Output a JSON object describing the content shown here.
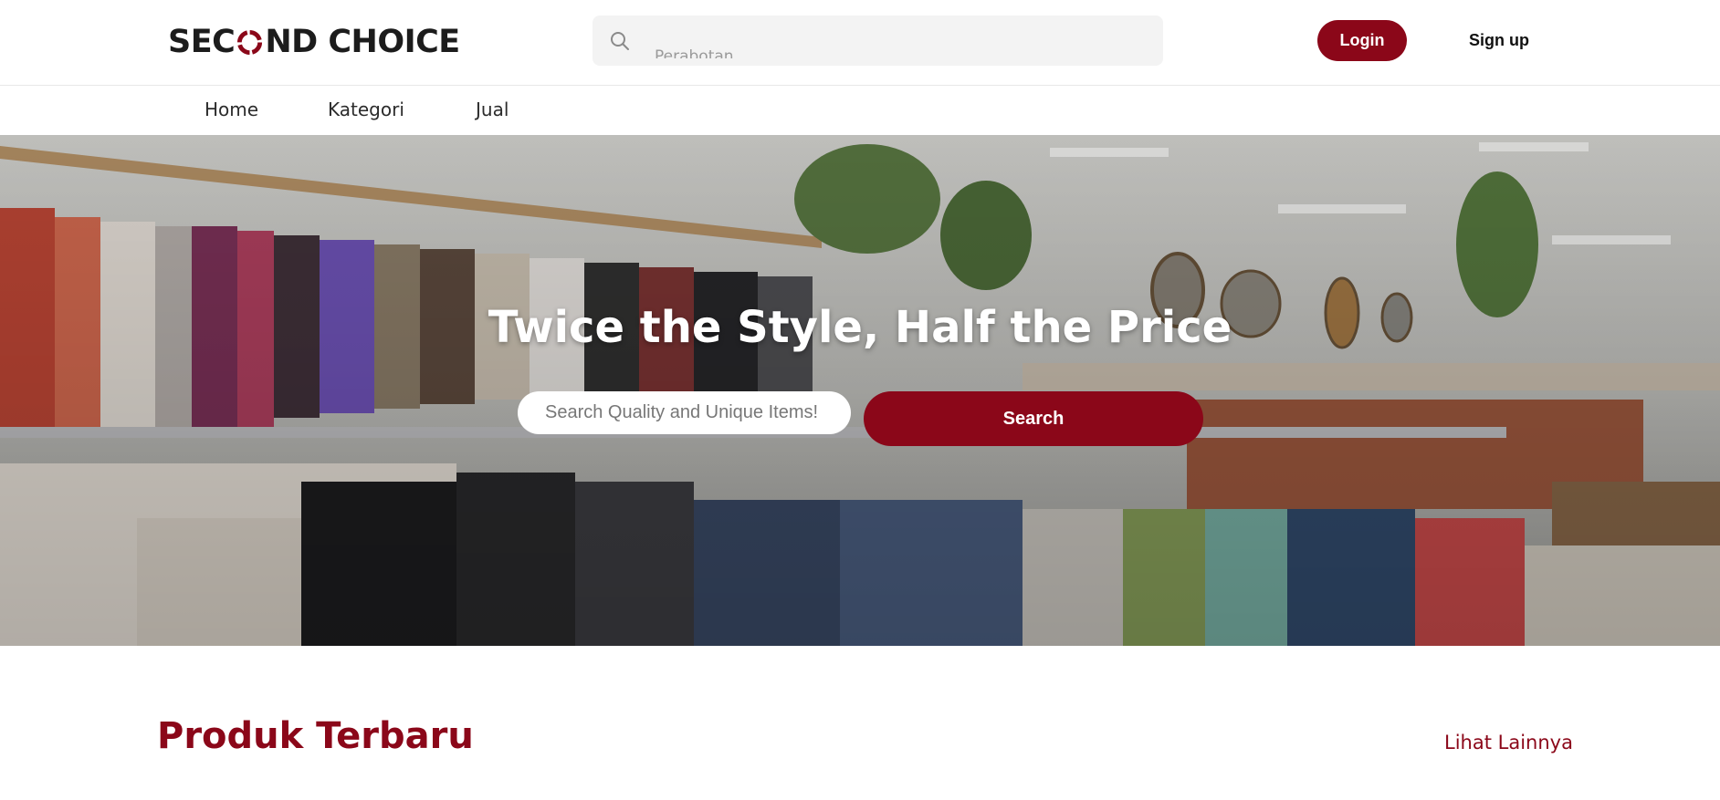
{
  "brand": {
    "name_part1": "SEC",
    "name_part2": "ND CHOICE",
    "accent": "#8b0719",
    "logo_icon": "recycle-ring-icon"
  },
  "header": {
    "search_placeholder": "Perabotan",
    "search_icon": "search-icon",
    "login_label": "Login",
    "signup_label": "Sign up"
  },
  "nav": {
    "items": [
      {
        "label": "Home"
      },
      {
        "label": "Kategori"
      },
      {
        "label": "Jual"
      }
    ]
  },
  "hero": {
    "title": "Twice the Style, Half the Price",
    "search_placeholder": "Search Quality and Unique Items!",
    "search_button": "Search",
    "image": "thrift-store-clothing-racks"
  },
  "section": {
    "title": "Produk Terbaru",
    "see_more": "Lihat Lainnya"
  }
}
